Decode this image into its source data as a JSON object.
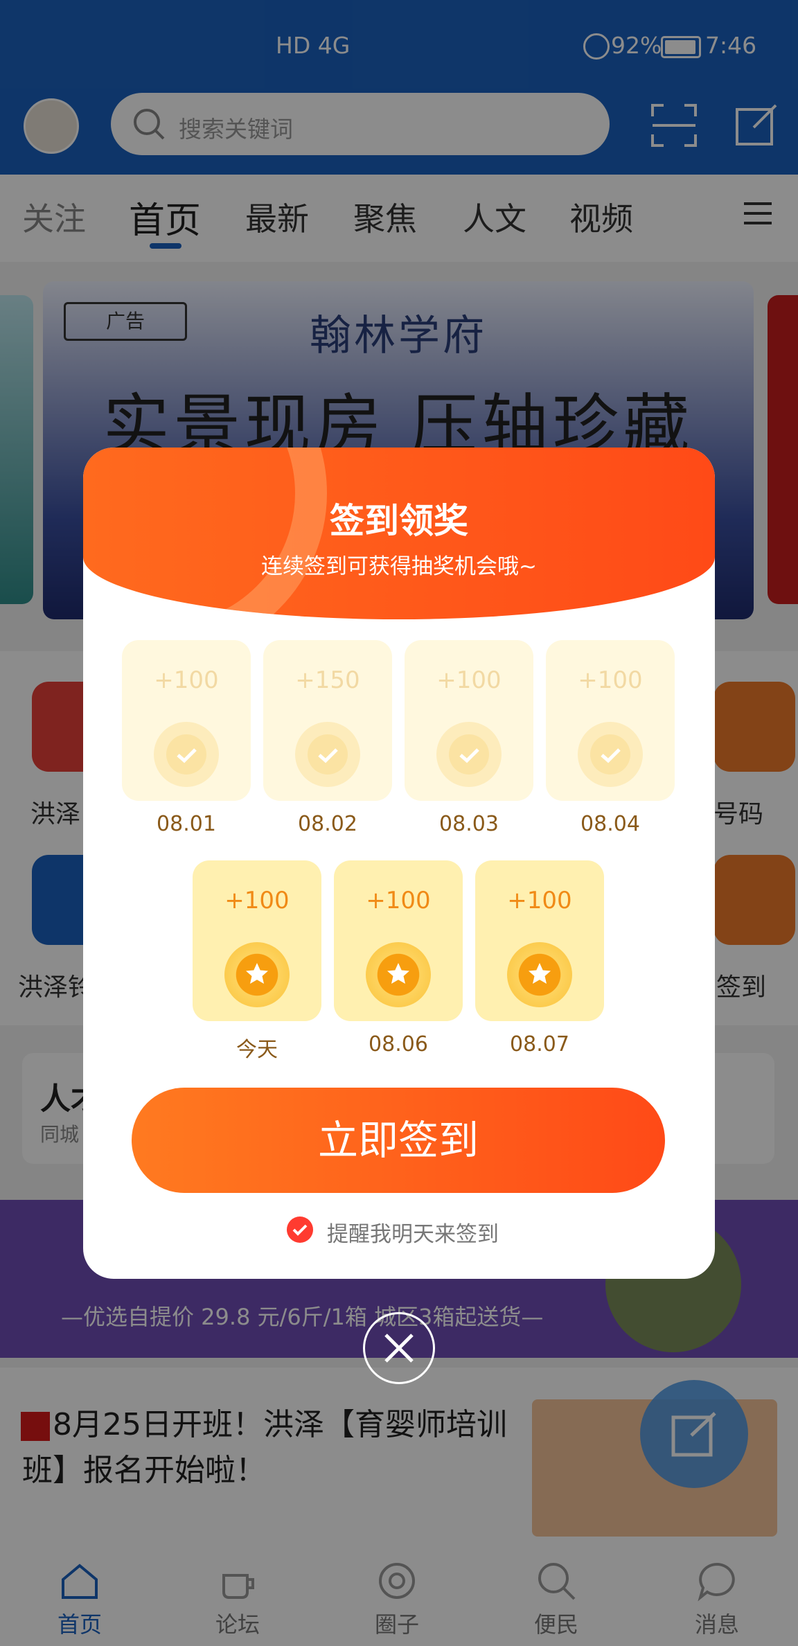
{
  "status_bar": {
    "signal_label": "HD 4G",
    "battery": "92%",
    "time": "7:46"
  },
  "header": {
    "search_placeholder": "搜索关键词"
  },
  "tabs": [
    "关注",
    "首页",
    "最新",
    "聚焦",
    "人文",
    "视频"
  ],
  "banner": {
    "tag": "广告",
    "title": "翰林学府",
    "slogan": "实景现房 压轴珍藏"
  },
  "grid_partial_labels": [
    "洪泽",
    "号码",
    "洪泽铃",
    "签到"
  ],
  "card": {
    "title_partial": "人才",
    "sub_partial": "同城"
  },
  "promo": {
    "text": "—优选自提价 29.8 元/6斤/1箱 城区3箱起送货—"
  },
  "news": {
    "title": "8月25日开班！洪泽【育婴师培训班】报名开始啦！"
  },
  "bottom_nav": [
    "首页",
    "论坛",
    "圈子",
    "便民",
    "消息"
  ],
  "popup": {
    "title": "签到领奖",
    "subtitle": "连续签到可获得抽奖机会哦~",
    "days_row1": [
      {
        "points": "+100",
        "date": "08.01",
        "status": "done"
      },
      {
        "points": "+150",
        "date": "08.02",
        "status": "done"
      },
      {
        "points": "+100",
        "date": "08.03",
        "status": "done"
      },
      {
        "points": "+100",
        "date": "08.04",
        "status": "done"
      }
    ],
    "days_row2": [
      {
        "points": "+100",
        "date": "今天",
        "status": "todo"
      },
      {
        "points": "+100",
        "date": "08.06",
        "status": "todo"
      },
      {
        "points": "+100",
        "date": "08.07",
        "status": "todo"
      }
    ],
    "button": "立即签到",
    "remind": "提醒我明天来签到"
  },
  "colors": {
    "brand_blue": "#1b62c0",
    "accent_orange": "#ff5a1a"
  }
}
